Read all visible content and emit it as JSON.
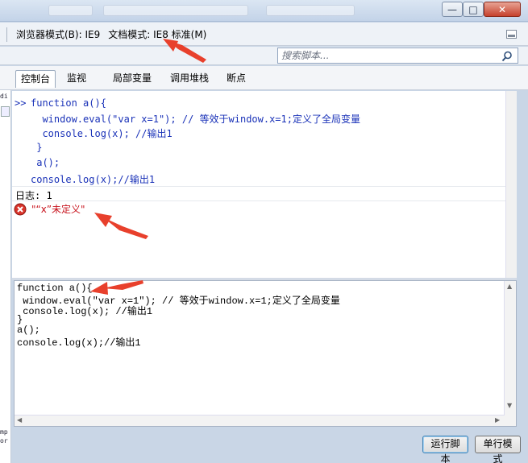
{
  "window": {
    "minimize_label": "—",
    "maximize_label": "□",
    "close_label": "✕"
  },
  "modebar": {
    "browser_mode": "浏览器模式(B): IE9",
    "document_mode": "文档模式: IE8 标准(M)"
  },
  "search": {
    "placeholder": "搜索脚本..."
  },
  "tabs": [
    {
      "label": "控制台"
    },
    {
      "label": "监视"
    },
    {
      "label": "局部变量"
    },
    {
      "label": "调用堆栈"
    },
    {
      "label": "断点"
    }
  ],
  "console": {
    "prompt": ">>",
    "lines": [
      "function a(){",
      "  window.eval(\"var x=1\"); // 等效于window.x=1;定义了全局变量",
      "  console.log(x); //输出1",
      " }",
      " a();",
      "console.log(x);//输出1"
    ],
    "log": "日志: 1",
    "error": "\"“x”未定义\""
  },
  "editor": {
    "lines": [
      "function a(){",
      " window.eval(\"var x=1\"); // 等效于window.x=1;定义了全局变量",
      " console.log(x); //输出1",
      "}",
      "a();",
      "console.log(x);//输出1"
    ]
  },
  "buttons": {
    "run": "运行脚本",
    "single_line": "单行模式"
  },
  "left_strip": {
    "top_text": "di",
    "bottom_text_1": "mp",
    "bottom_text_2": "or"
  },
  "colors": {
    "code_blue": "#1a32b8",
    "error_red": "#c8141e",
    "annotation_arrow": "#e8402c"
  }
}
